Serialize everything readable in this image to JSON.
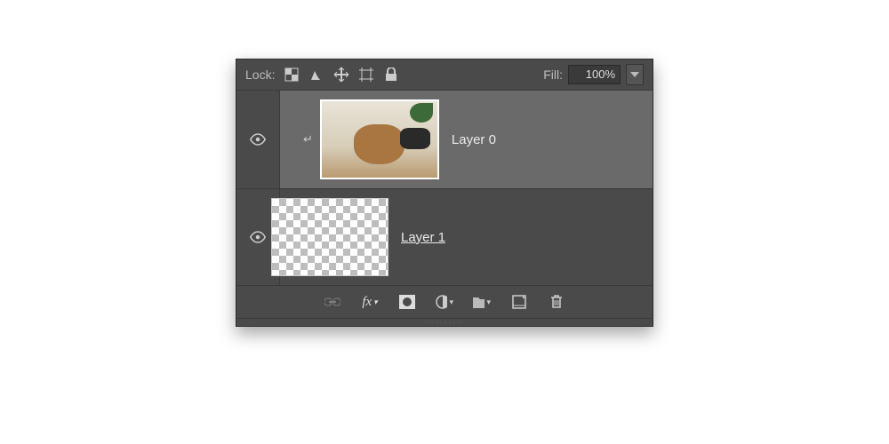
{
  "lockbar": {
    "label": "Lock:",
    "fill_label": "Fill:",
    "fill_value": "100%"
  },
  "layers": [
    {
      "name": "Layer 0",
      "clipped": true,
      "selected": true,
      "underline": false,
      "thumb": "image"
    },
    {
      "name": "Layer 1",
      "clipped": false,
      "selected": false,
      "underline": true,
      "thumb": "transparent"
    }
  ]
}
